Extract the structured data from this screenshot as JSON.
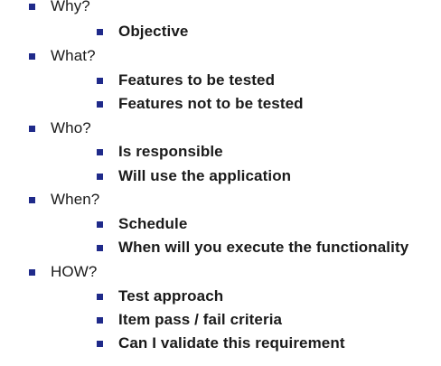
{
  "outline": [
    {
      "heading": "Why?",
      "subitems": [
        "Objective"
      ]
    },
    {
      "heading": "What?",
      "subitems": [
        "Features to be tested",
        "Features not to be tested"
      ]
    },
    {
      "heading": "Who?",
      "subitems": [
        "Is responsible",
        "Will use the application"
      ]
    },
    {
      "heading": "When?",
      "subitems": [
        "Schedule",
        "When will you execute the functionality"
      ]
    },
    {
      "heading": "HOW?",
      "subitems": [
        "Test approach",
        "Item pass / fail criteria",
        "Can I validate this requirement"
      ]
    }
  ],
  "colors": {
    "bullet": "#1f2a8a",
    "text": "#1a1a1a",
    "background": "#ffffff"
  }
}
